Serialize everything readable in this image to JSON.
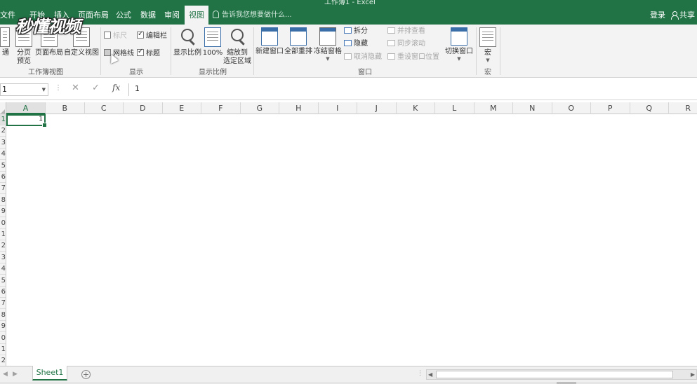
{
  "window": {
    "title": "工作簿1 - Excel"
  },
  "tabs": [
    "文件",
    "开始",
    "插入",
    "页面布局",
    "公式",
    "数据",
    "审阅",
    "视图"
  ],
  "active_tab": "视图",
  "tell_me": "告诉我您想要做什么...",
  "account": {
    "login": "登录",
    "share": "共享"
  },
  "watermark": "秒懂视频",
  "ribbon": {
    "workbook_views": {
      "label": "工作簿视图",
      "normal": "通",
      "page_break_l1": "分页",
      "page_break_l2": "预览",
      "page_layout": "页面布局",
      "custom_views": "自定义视图"
    },
    "show": {
      "label": "显示",
      "ruler": "标尺",
      "formula_bar": "编辑栏",
      "gridlines": "网格线",
      "headings": "标题",
      "ruler_checked": false,
      "formula_bar_checked": true,
      "gridlines_checked": false,
      "headings_checked": true
    },
    "zoom": {
      "label": "显示比例",
      "zoom": "显示比例",
      "zoom_100": "100%",
      "zoom_sel_l1": "缩放到",
      "zoom_sel_l2": "选定区域"
    },
    "window": {
      "label": "窗口",
      "new_window": "新建窗口",
      "arrange_all": "全部重排",
      "freeze_panes": "冻结窗格",
      "split": "拆分",
      "hide": "隐藏",
      "unhide": "取消隐藏",
      "side_by_side": "并排查看",
      "sync_scroll": "同步滚动",
      "reset_position": "重设窗口位置",
      "switch_windows": "切换窗口"
    },
    "macros": {
      "label": "宏",
      "macros": "宏"
    }
  },
  "formula_bar": {
    "name_box": "1",
    "cancel_icon": "✕",
    "enter_icon": "✓",
    "fx": "fx",
    "content": "1"
  },
  "grid": {
    "columns": [
      "A",
      "B",
      "C",
      "D",
      "E",
      "F",
      "G",
      "H",
      "I",
      "J",
      "K",
      "L",
      "M",
      "N",
      "O",
      "P",
      "Q",
      "R"
    ],
    "rows": [
      "1",
      "2",
      "3",
      "4",
      "5",
      "6",
      "7",
      "8",
      "9",
      "0",
      "1",
      "2",
      "3",
      "4",
      "5",
      "6",
      "7",
      "8",
      "9",
      "0",
      "1",
      "2"
    ],
    "active_cell_value": "1"
  },
  "sheets": [
    "Sheet1"
  ],
  "add_sheet": "+"
}
